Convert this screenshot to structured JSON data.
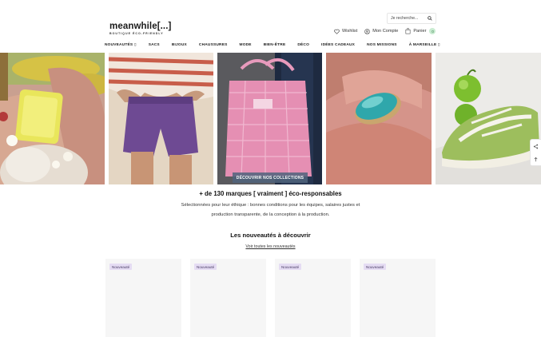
{
  "header": {
    "logo_name": "meanwhile[...]",
    "logo_tagline": "BOUTIQUE ÉCO-FRIENDLY",
    "search_placeholder": "Je recherche...",
    "wishlist_label": "Wishlist",
    "account_label": "Mon Compte",
    "cart_label": "Panier",
    "cart_count": "0"
  },
  "nav": {
    "items": [
      "NOUVEAUTÉS ▯",
      "SACS",
      "BIJOUX",
      "CHAUSSURES",
      "MODE",
      "BIEN-ÊTRE",
      "DÉCO",
      "IDÉES CADEAUX",
      "NOS MISSIONS",
      "À MARSEILLE ▯"
    ]
  },
  "banner": {
    "cta_label": "DÉCOUVRIR NOS COLLECTIONS"
  },
  "intro": {
    "title": "+ de 130 marques [ vraiment ] éco-responsables",
    "line1": "Sélectionnées pour leur éthique : bonnes conditions pour les équipes, salaires justes et",
    "line2": "production transparente, de la conception à la production."
  },
  "new_arrivals": {
    "title": "Les nouveautés à découvrir",
    "link_label": "Voir toutes les nouveautés",
    "products": [
      {
        "tag": "Nouveauté"
      },
      {
        "tag": "Nouveauté"
      },
      {
        "tag": "Nouveauté"
      },
      {
        "tag": "Nouveauté"
      }
    ]
  },
  "colors": {
    "accent_badge": "#c9ebd1",
    "tag_bg": "#e5dcf3",
    "cta_bg": "#50647d"
  }
}
